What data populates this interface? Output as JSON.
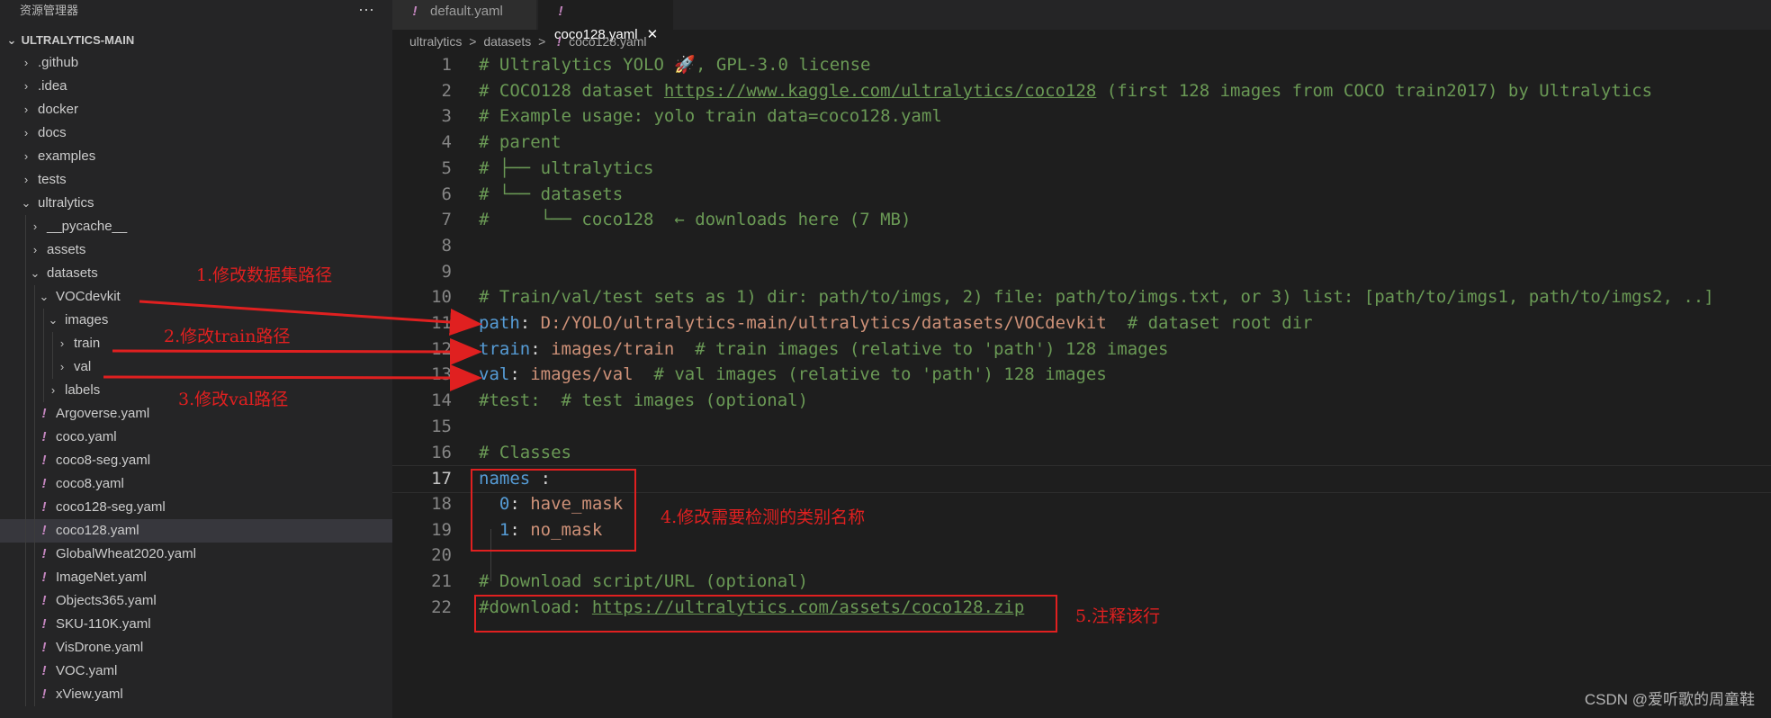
{
  "explorer": {
    "title": "资源管理器",
    "more": "···",
    "root": "ULTRALYTICS-MAIN",
    "items": [
      {
        "label": ".github",
        "type": "folder",
        "depth": 1,
        "expanded": false
      },
      {
        "label": ".idea",
        "type": "folder",
        "depth": 1,
        "expanded": false
      },
      {
        "label": "docker",
        "type": "folder",
        "depth": 1,
        "expanded": false
      },
      {
        "label": "docs",
        "type": "folder",
        "depth": 1,
        "expanded": false
      },
      {
        "label": "examples",
        "type": "folder",
        "depth": 1,
        "expanded": false
      },
      {
        "label": "tests",
        "type": "folder",
        "depth": 1,
        "expanded": false
      },
      {
        "label": "ultralytics",
        "type": "folder",
        "depth": 1,
        "expanded": true
      },
      {
        "label": "__pycache__",
        "type": "folder",
        "depth": 2,
        "expanded": false
      },
      {
        "label": "assets",
        "type": "folder",
        "depth": 2,
        "expanded": false
      },
      {
        "label": "datasets",
        "type": "folder",
        "depth": 2,
        "expanded": true
      },
      {
        "label": "VOCdevkit",
        "type": "folder",
        "depth": 3,
        "expanded": true
      },
      {
        "label": "images",
        "type": "folder",
        "depth": 4,
        "expanded": true
      },
      {
        "label": "train",
        "type": "folder",
        "depth": 5,
        "expanded": false
      },
      {
        "label": "val",
        "type": "folder",
        "depth": 5,
        "expanded": false
      },
      {
        "label": "labels",
        "type": "folder",
        "depth": 4,
        "expanded": false
      },
      {
        "label": "Argoverse.yaml",
        "type": "file",
        "depth": 3
      },
      {
        "label": "coco.yaml",
        "type": "file",
        "depth": 3
      },
      {
        "label": "coco8-seg.yaml",
        "type": "file",
        "depth": 3
      },
      {
        "label": "coco8.yaml",
        "type": "file",
        "depth": 3
      },
      {
        "label": "coco128-seg.yaml",
        "type": "file",
        "depth": 3
      },
      {
        "label": "coco128.yaml",
        "type": "file",
        "depth": 3,
        "selected": true
      },
      {
        "label": "GlobalWheat2020.yaml",
        "type": "file",
        "depth": 3
      },
      {
        "label": "ImageNet.yaml",
        "type": "file",
        "depth": 3
      },
      {
        "label": "Objects365.yaml",
        "type": "file",
        "depth": 3
      },
      {
        "label": "SKU-110K.yaml",
        "type": "file",
        "depth": 3
      },
      {
        "label": "VisDrone.yaml",
        "type": "file",
        "depth": 3
      },
      {
        "label": "VOC.yaml",
        "type": "file",
        "depth": 3
      },
      {
        "label": "xView.yaml",
        "type": "file",
        "depth": 3
      }
    ]
  },
  "tabs": [
    {
      "label": "default.yaml",
      "active": false
    },
    {
      "label": "coco128.yaml",
      "active": true,
      "close": "✕"
    }
  ],
  "breadcrumb": {
    "parts": [
      "ultralytics",
      "datasets"
    ],
    "file": "coco128.yaml",
    "sep": ">"
  },
  "editor": {
    "current_line": 17,
    "lines": [
      {
        "n": "1",
        "segs": [
          {
            "t": "# Ultralytics YOLO 🚀, GPL-3.0 license",
            "c": "cm"
          }
        ]
      },
      {
        "n": "2",
        "segs": [
          {
            "t": "# COCO128 dataset ",
            "c": "cm"
          },
          {
            "t": "https://www.kaggle.com/ultralytics/coco128",
            "c": "link"
          },
          {
            "t": " (first 128 images from COCO train2017) by Ultralytics",
            "c": "cm"
          }
        ]
      },
      {
        "n": "3",
        "segs": [
          {
            "t": "# Example usage: yolo train data=coco128.yaml",
            "c": "cm"
          }
        ]
      },
      {
        "n": "4",
        "segs": [
          {
            "t": "# parent",
            "c": "cm"
          }
        ]
      },
      {
        "n": "5",
        "segs": [
          {
            "t": "# ├── ultralytics",
            "c": "cm"
          }
        ]
      },
      {
        "n": "6",
        "segs": [
          {
            "t": "# └── datasets",
            "c": "cm"
          }
        ]
      },
      {
        "n": "7",
        "segs": [
          {
            "t": "#     └── coco128  ← downloads here (7 MB)",
            "c": "cm"
          }
        ]
      },
      {
        "n": "8",
        "segs": []
      },
      {
        "n": "9",
        "segs": []
      },
      {
        "n": "10",
        "segs": [
          {
            "t": "# Train/val/test sets as 1) dir: path/to/imgs, 2) file: path/to/imgs.txt, or 3) list: [path/to/imgs1, path/to/imgs2, ..]",
            "c": "cm"
          }
        ]
      },
      {
        "n": "11",
        "segs": [
          {
            "t": "path",
            "c": "key"
          },
          {
            "t": ": ",
            "c": "op"
          },
          {
            "t": "D:/YOLO/ultralytics-main/ultralytics/datasets/VOCdevkit",
            "c": "val"
          },
          {
            "t": "  # dataset root dir",
            "c": "cm"
          }
        ]
      },
      {
        "n": "12",
        "segs": [
          {
            "t": "train",
            "c": "key"
          },
          {
            "t": ": ",
            "c": "op"
          },
          {
            "t": "images/train",
            "c": "val"
          },
          {
            "t": "  # train images (relative to 'path') 128 images",
            "c": "cm"
          }
        ]
      },
      {
        "n": "13",
        "segs": [
          {
            "t": "val",
            "c": "key"
          },
          {
            "t": ": ",
            "c": "op"
          },
          {
            "t": "images/val",
            "c": "val"
          },
          {
            "t": "  # val images (relative to 'path') 128 images",
            "c": "cm"
          }
        ]
      },
      {
        "n": "14",
        "segs": [
          {
            "t": "#test:  # test images (optional)",
            "c": "cm"
          }
        ]
      },
      {
        "n": "15",
        "segs": []
      },
      {
        "n": "16",
        "segs": [
          {
            "t": "# Classes",
            "c": "cm"
          }
        ]
      },
      {
        "n": "17",
        "segs": [
          {
            "t": "names",
            "c": "key"
          },
          {
            "t": " :",
            "c": "op"
          }
        ]
      },
      {
        "n": "18",
        "segs": [
          {
            "t": "  0",
            "c": "key"
          },
          {
            "t": ": ",
            "c": "op"
          },
          {
            "t": "have_mask",
            "c": "val"
          }
        ]
      },
      {
        "n": "19",
        "segs": [
          {
            "t": "  1",
            "c": "key"
          },
          {
            "t": ": ",
            "c": "op"
          },
          {
            "t": "no_mask",
            "c": "val"
          }
        ]
      },
      {
        "n": "20",
        "segs": []
      },
      {
        "n": "21",
        "segs": [
          {
            "t": "# Download script/URL (optional)",
            "c": "cm"
          }
        ]
      },
      {
        "n": "22",
        "segs": [
          {
            "t": "#download: ",
            "c": "cm"
          },
          {
            "t": "https://ultralytics.com/assets/coco128.zip",
            "c": "link"
          }
        ]
      }
    ]
  },
  "annotations": {
    "a1": "1.修改数据集路径",
    "a2": "2.修改train路径",
    "a3": "3.修改val路径",
    "a4": "4.修改需要检测的类别名称",
    "a5": "5.注释该行"
  },
  "watermark": "CSDN @爱听歌的周童鞋",
  "colors": {
    "annotation": "#e02020",
    "comment": "#6a9955",
    "key": "#569cd6",
    "string": "#ce9178",
    "yaml_icon": "#c586c0"
  }
}
